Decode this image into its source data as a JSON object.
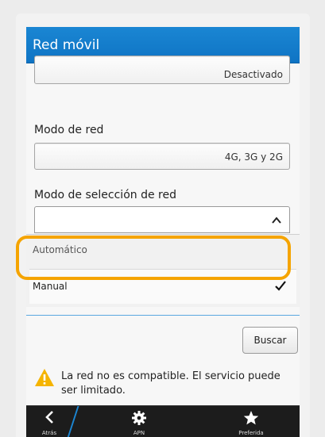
{
  "header": {
    "title": "Red móvil"
  },
  "fields": {
    "top_value": "Desactivado",
    "network_mode": {
      "label": "Modo de red",
      "value": "4G, 3G y 2G"
    },
    "selection_mode": {
      "label": "Modo de selección de red",
      "options": [
        "Automático",
        "Manual"
      ],
      "selected": "Manual"
    }
  },
  "search_button": "Buscar",
  "warning": "La red no es compatible. El servicio puede ser limitado.",
  "actionbar": {
    "back": "Atrás",
    "apn": "APN",
    "preferred": "Preferida"
  },
  "colors": {
    "titlebar": "#1a86d3",
    "highlight": "#f5a400",
    "warning": "#f5b400"
  },
  "icons": [
    "chevron-up-icon",
    "checkmark-icon",
    "warning-icon",
    "back-arrow-icon",
    "gear-icon",
    "star-icon"
  ]
}
